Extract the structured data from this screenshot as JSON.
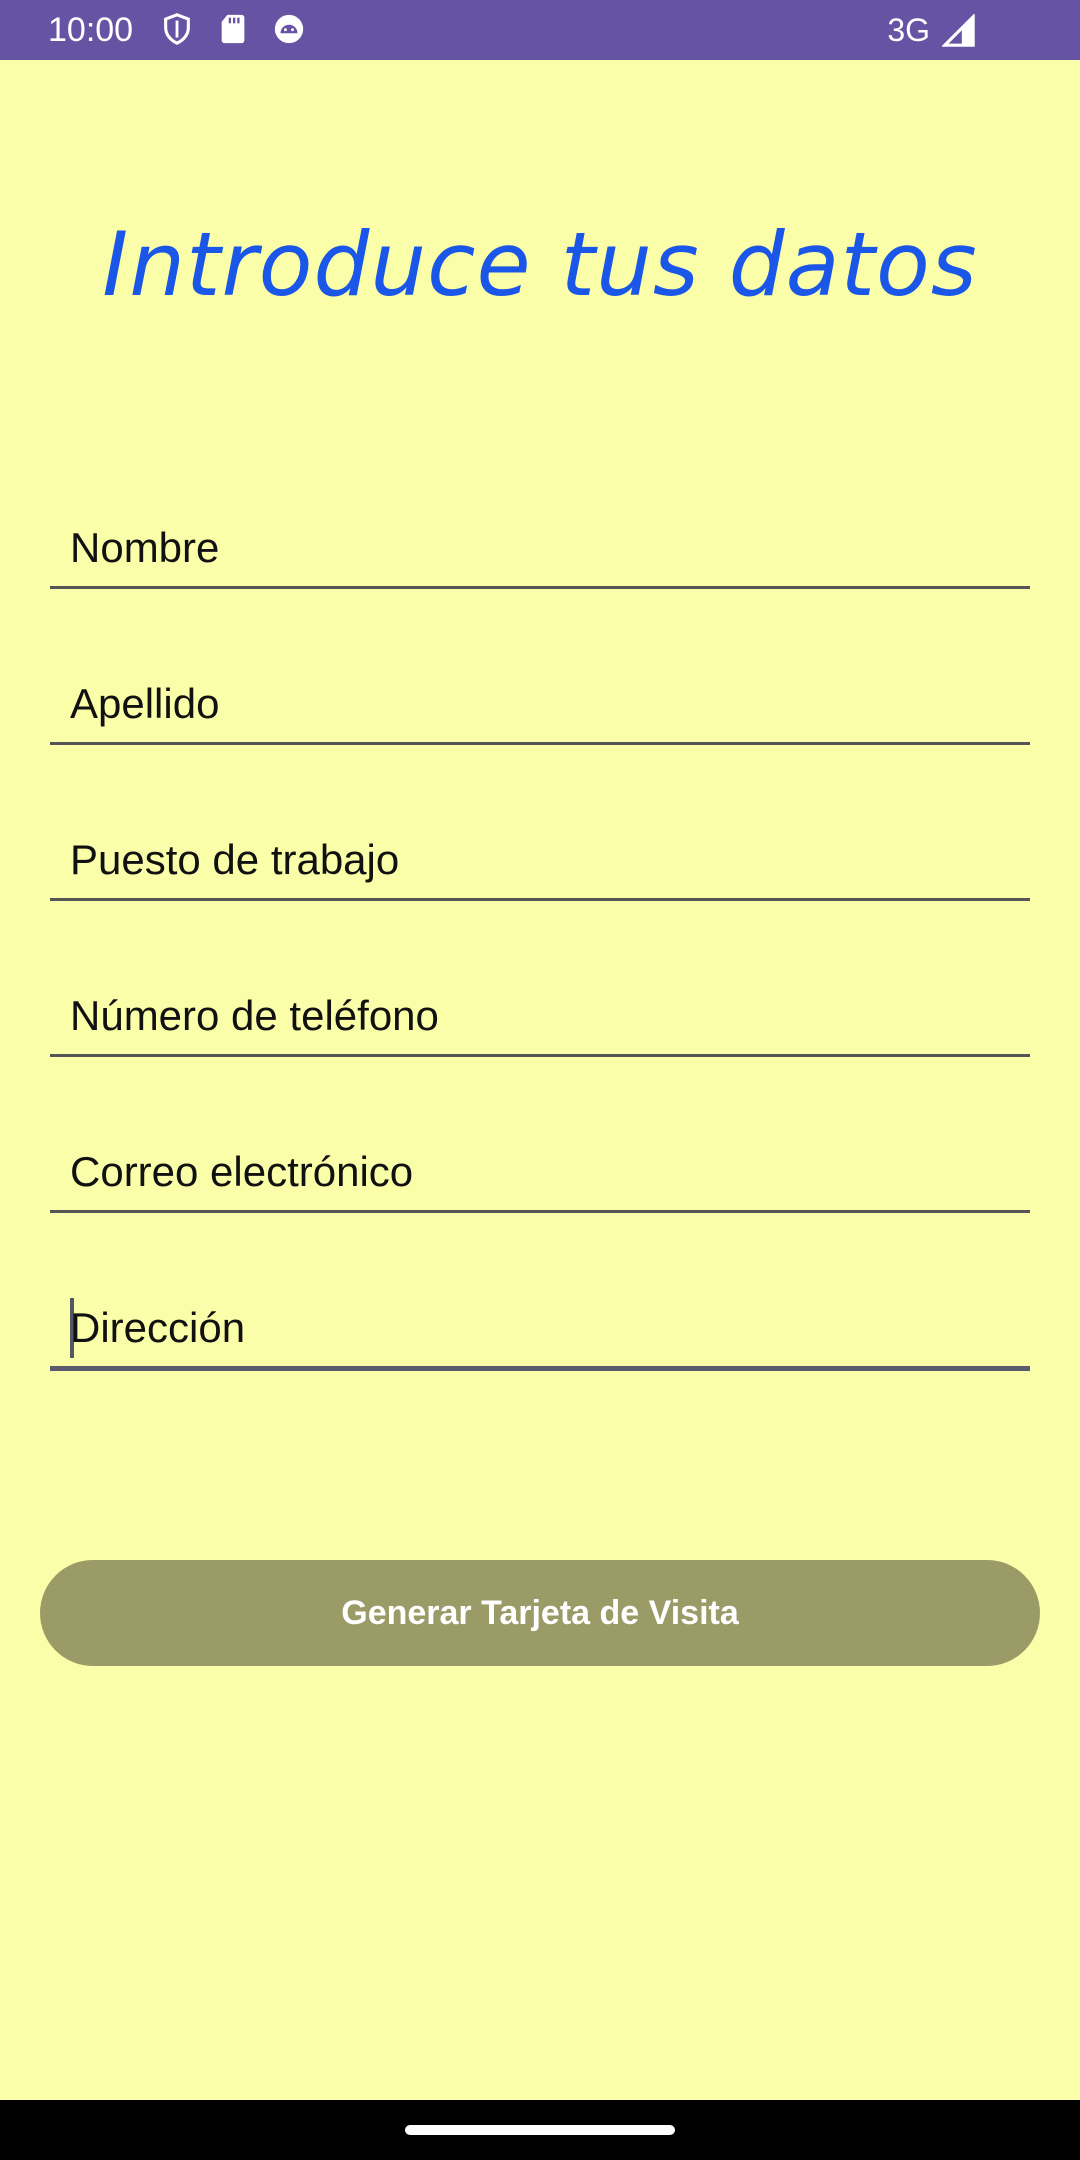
{
  "status_bar": {
    "time": "10:00",
    "network": "3G",
    "icons": [
      "shield-icon",
      "sd-card-icon",
      "android-icon",
      "signal-icon"
    ]
  },
  "form": {
    "title": "Introduce tus datos",
    "fields": [
      {
        "placeholder": "Nombre"
      },
      {
        "placeholder": "Apellido"
      },
      {
        "placeholder": "Puesto de trabajo"
      },
      {
        "placeholder": "Número de teléfono"
      },
      {
        "placeholder": "Correo electrónico"
      },
      {
        "placeholder": "Dirección"
      }
    ],
    "submit_label": "Generar Tarjeta de Visita"
  },
  "colors": {
    "background": "#fbfea8",
    "status_bar": "#6753a4",
    "title": "#1a56e8",
    "button": "#9b9b68"
  }
}
